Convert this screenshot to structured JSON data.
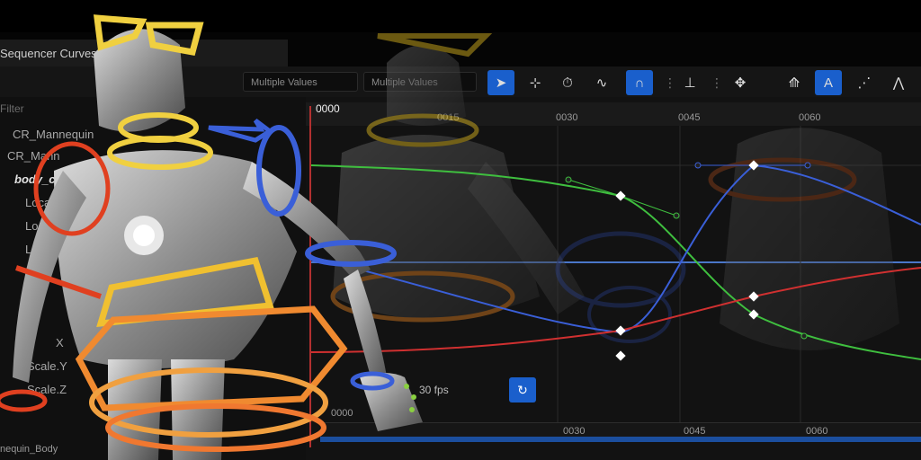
{
  "window": {
    "title": "Sequencer Curves"
  },
  "toolbar": {
    "field_left": "Multiple Values",
    "field_right": "Multiple Values",
    "buttons": [
      "select-icon",
      "marquee-icon",
      "timer-icon",
      "curve-normalize-icon",
      "snap-magnet-icon",
      "retime-icon",
      "transform-icon",
      "flatten-icon",
      "auto-tangent-icon",
      "tangent-break-icon",
      "tangent-weight-icon"
    ],
    "active_buttons": [
      "select-icon",
      "snap-magnet-icon",
      "auto-tangent-icon"
    ]
  },
  "outliner": {
    "filter_placeholder": "Filter",
    "items": [
      {
        "label": "CR_Mannequin"
      },
      {
        "label": "CR_Mann"
      },
      {
        "label": "body_c"
      },
      {
        "label": "Loca"
      },
      {
        "label": "Loca"
      },
      {
        "label": "Loca"
      },
      {
        "label": "X"
      },
      {
        "label": "Scale.Y"
      },
      {
        "label": "Scale.Z"
      }
    ]
  },
  "timeline": {
    "current_frame": "0000",
    "ticks": [
      "0015",
      "0030",
      "0045",
      "0060"
    ],
    "bottom_ticks": [
      "0000",
      "0030",
      "0045",
      "0060"
    ]
  },
  "playback": {
    "fps": "30 fps"
  },
  "status": {
    "asset": "nequin_Body"
  },
  "colors": {
    "accent": "#1a5fcc",
    "curve_green": "#3fbf3f",
    "curve_blue": "#3a5fd8",
    "curve_red": "#d03030",
    "gizmo_yellow": "#f0d040",
    "gizmo_orange": "#f08a30"
  }
}
